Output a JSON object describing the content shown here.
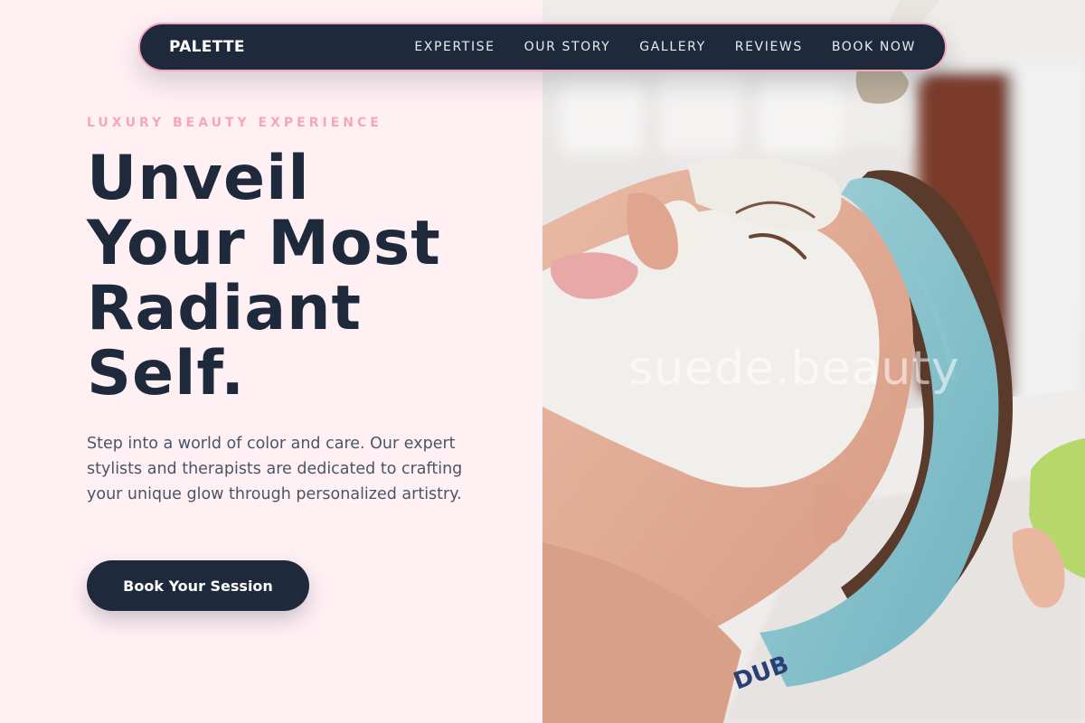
{
  "nav": {
    "brand": "PALETTE",
    "links": [
      "EXPERTISE",
      "OUR STORY",
      "GALLERY",
      "REVIEWS",
      "BOOK NOW"
    ]
  },
  "hero": {
    "eyebrow": "LUXURY BEAUTY EXPERIENCE",
    "headline_lines": [
      "Unveil",
      "Your Most",
      "Radiant",
      "Self."
    ],
    "body": "Step into a world of color and care. Our expert stylists and therapists are dedicated to crafting your unique glow through personalized artistry.",
    "cta_label": "Book Your Session"
  },
  "photo": {
    "watermark": "suede.beauty",
    "headband_text": "DUB"
  },
  "colors": {
    "navy": "#1e293b",
    "pink_bg": "#fff0f4",
    "pink_accent": "#f4a7bc",
    "body_text": "#4a5568"
  }
}
